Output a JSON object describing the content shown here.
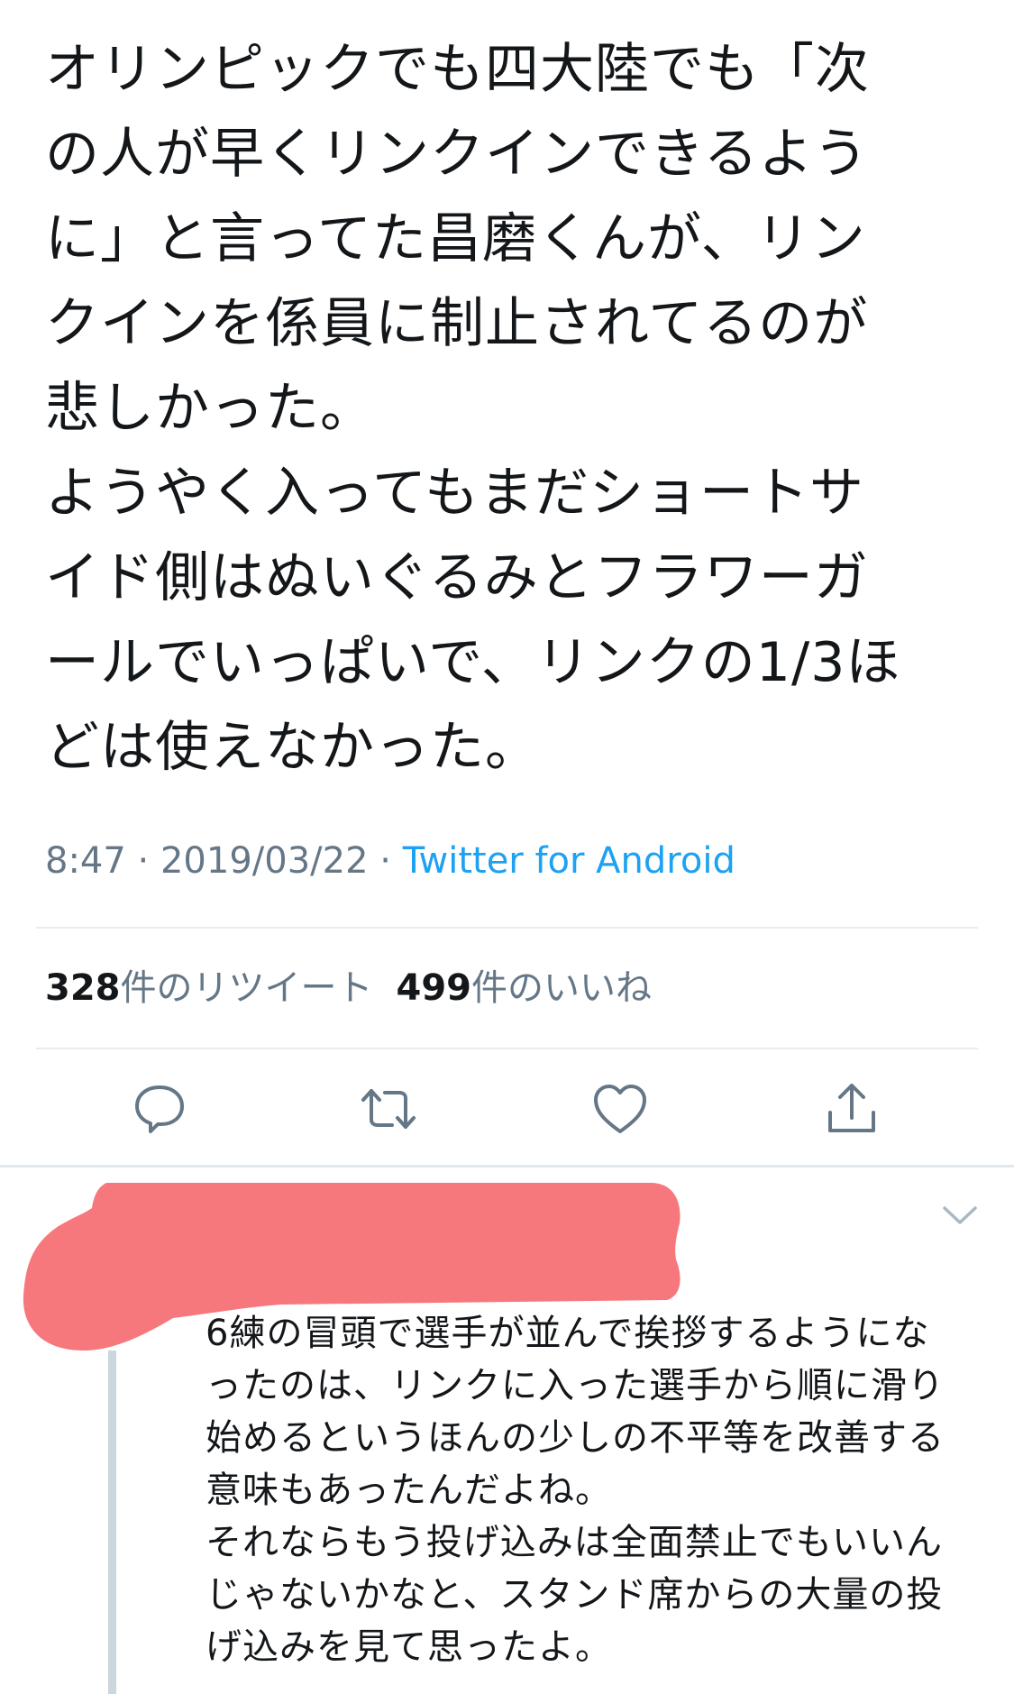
{
  "tweet": {
    "text": "オリンピックでも四大陸でも「次\nの人が早くリンクインできるよう\nに」と言ってた昌磨くんが、リン\nクインを係員に制止されてるのが\n悲しかった。\nようやく入ってもまだショートサ\nイド側はぬいぐるみとフラワーガ\nールでいっぱいで、リンクの1/3ほ\nどは使えなかった。",
    "time": "8:47",
    "date": "2019/03/22",
    "separator": " · ",
    "source": "Twitter for Android"
  },
  "stats": {
    "retweets_count": "328",
    "retweets_label": "件のリツイート",
    "likes_count": "499",
    "likes_label": "件のいいね"
  },
  "actions": {
    "reply_icon": "reply-icon",
    "retweet_icon": "retweet-icon",
    "like_icon": "heart-icon",
    "share_icon": "share-icon"
  },
  "reply": {
    "redaction_color": "#f7787c",
    "text": "6練の冒頭で選手が並んで挨拶するようにな\nったのは、リンクに入った選手から順に滑り\n始めるというほんの少しの不平等を改善する\n意味もあったんだよね。\nそれならもう投げ込みは全面禁止でもいいん\nじゃないかなと、スタンド席からの大量の投\nげ込みを見て思ったよ。"
  },
  "colors": {
    "text": "#14171a",
    "secondary": "#657786",
    "accent": "#1da1f2",
    "divider": "#e6ecf0",
    "icon": "#657786"
  }
}
